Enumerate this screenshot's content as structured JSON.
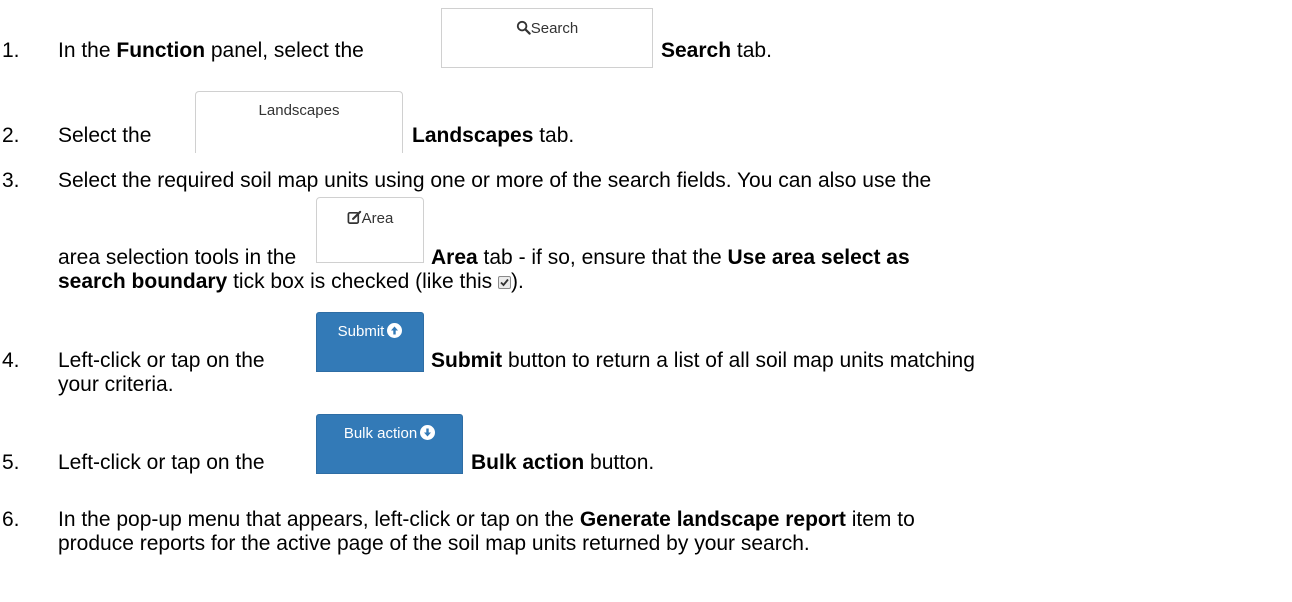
{
  "steps": [
    {
      "num": "1.",
      "t1": "In the ",
      "b1": "Function",
      "t2": " panel, select the ",
      "b2": "Search",
      "t3": " tab."
    },
    {
      "num": "2.",
      "t1": "Select the ",
      "b1": "Landscapes",
      "t2": " tab."
    },
    {
      "num": "3.",
      "l1": "Select the required soil map units using one or more of the search fields. You can also use the",
      "l2a": "area selection tools in the ",
      "l2b": "Area",
      "l2c": " tab - if so, ensure that the ",
      "l2d": "Use area select as",
      "l3a": "search boundary",
      "l3b": " tick box is checked (like this ",
      "l3c": ")."
    },
    {
      "num": "4.",
      "t1": "Left-click or tap on the ",
      "b1": "Submit",
      "t2": " button to return a list of all soil map units matching",
      "l2": "your criteria."
    },
    {
      "num": "5.",
      "t1": "Left-click or tap on the ",
      "b1": "Bulk action",
      "t2": " button."
    },
    {
      "num": "6.",
      "t1": "In the pop-up menu that appears, left-click or tap on the ",
      "b1": "Generate landscape report",
      "t2": " item to",
      "l2": "produce reports for the active page of the soil map units returned by your search."
    }
  ],
  "images": {
    "search_tab": "Search",
    "landscapes_tab": "Landscapes",
    "area_tab": "Area",
    "submit_button": "Submit",
    "bulk_button": "Bulk action"
  },
  "colors": {
    "primary_button": "#337ab7",
    "tab_border": "#d0d0d0"
  },
  "icons": [
    "search-icon",
    "edit-icon",
    "arrow-up-circle-icon",
    "arrow-down-circle-icon",
    "checkbox-checked-icon"
  ]
}
